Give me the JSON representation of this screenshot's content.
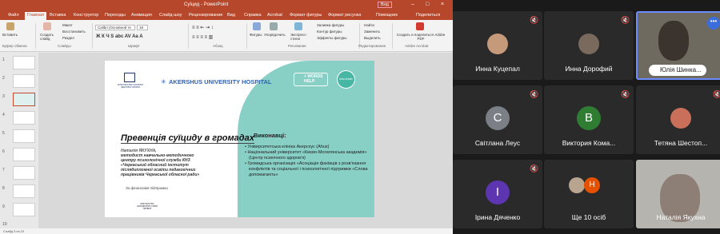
{
  "ppt": {
    "window_title": "Суїцид  -  PowerPoint",
    "account_button": "Вхід",
    "tabs": [
      "Файл",
      "Главная",
      "Вставка",
      "Конструктор",
      "Переходы",
      "Анимация",
      "Слайд-шоу",
      "Рецензирование",
      "Вид",
      "Справка",
      "Acrobat",
      "Формат фигуры",
      "Формат рисунка",
      "Помощник",
      "Поделиться"
    ],
    "active_tab": "Главная",
    "ribbon": {
      "paste": "Вставить",
      "layout": "Макет",
      "reset": "Восстановить",
      "section": "Раздел",
      "new_slide": "Создать слайд",
      "font_name": "Calibri (Основной те",
      "font_size": "18",
      "shapes": "Фигуры",
      "arrange": "Упорядочить",
      "quick_styles": "Экспресс-стили",
      "fill": "Заливка фигуры",
      "outline": "Контур фигуры",
      "effects": "Эффекты фигуры",
      "find": "Найти",
      "replace": "Заменить",
      "select": "Выделить",
      "create_pdf": "Создать и поделиться Adobe PDF",
      "groups": [
        "Буфер обмена",
        "Слайды",
        "Шрифт",
        "Абзац",
        "Рисование",
        "Редактирование",
        "Adobe Acrobat"
      ]
    },
    "slide_numbers": [
      "1",
      "2",
      "3",
      "4",
      "5",
      "6",
      "7",
      "8",
      "9",
      "10"
    ],
    "slide": {
      "ministry_logo_text": "МІНІСТЕРСТВО ОХОРОНИ ЗДОРОВ'Я УКРАЇНИ",
      "ahus": "AKERSHUS UNIVERSITY HOSPITAL",
      "words_help": [
        "+ WORDS",
        "HELP"
      ],
      "kirsi": "kirsi rehab",
      "title": "Превенція суїциду в громадах",
      "author_name": "Наталія ЯКУХНА,",
      "author_desc": "методист навчально-методичного центру психологічної служби КНЗ «Черкаський обласний інститут післядипломної освіти педагогічних працівників Черкаської обласної ради»",
      "support": "За фінансової підтримки",
      "ministry_footer": "МІНІСТЕРСТВО ЗАКОРДОННИХ СПРАВ НОРВЕГІЇ",
      "performers_heading": "Виконавці:",
      "performers": [
        "Університетська клініка Акерсхус (Ahus)",
        "Національний університет «Києво-Могилянська академія» (Центр психічного здоров'я)",
        "Громадська організація «Асоціація фахівців з розв'язання конфліктів та соціальної і психологічної підтримки «Слова допомагають»"
      ]
    },
    "status": "Слайд 3 из 10"
  },
  "zoom": {
    "tiles": [
      {
        "name": "Инна Куцепал",
        "muted": true,
        "kind": "photo",
        "color": "#c49a7a"
      },
      {
        "name": "Инна Дорофий",
        "muted": true,
        "kind": "photo",
        "color": "#7a6a5e"
      },
      {
        "name": "Юлія Шинка...",
        "muted": true,
        "kind": "video",
        "active": true
      },
      {
        "name": "Світлана Леус",
        "muted": true,
        "kind": "initial",
        "initial": "С",
        "color": "#7b7f86"
      },
      {
        "name": "Виктория Кома...",
        "muted": true,
        "kind": "initial",
        "initial": "В",
        "color": "#2e7d32"
      },
      {
        "name": "Тетяна Шестоп...",
        "muted": true,
        "kind": "photo",
        "color": "#c96f5a"
      },
      {
        "name": "Ірина Дяченко",
        "muted": true,
        "kind": "initial",
        "initial": "І",
        "color": "#5e35b1"
      },
      {
        "name": "Ще 10 осіб",
        "muted": false,
        "kind": "more",
        "initial": "Н",
        "color": "#e65100"
      },
      {
        "name": "Наталія Якухна",
        "muted": false,
        "kind": "video"
      }
    ]
  }
}
